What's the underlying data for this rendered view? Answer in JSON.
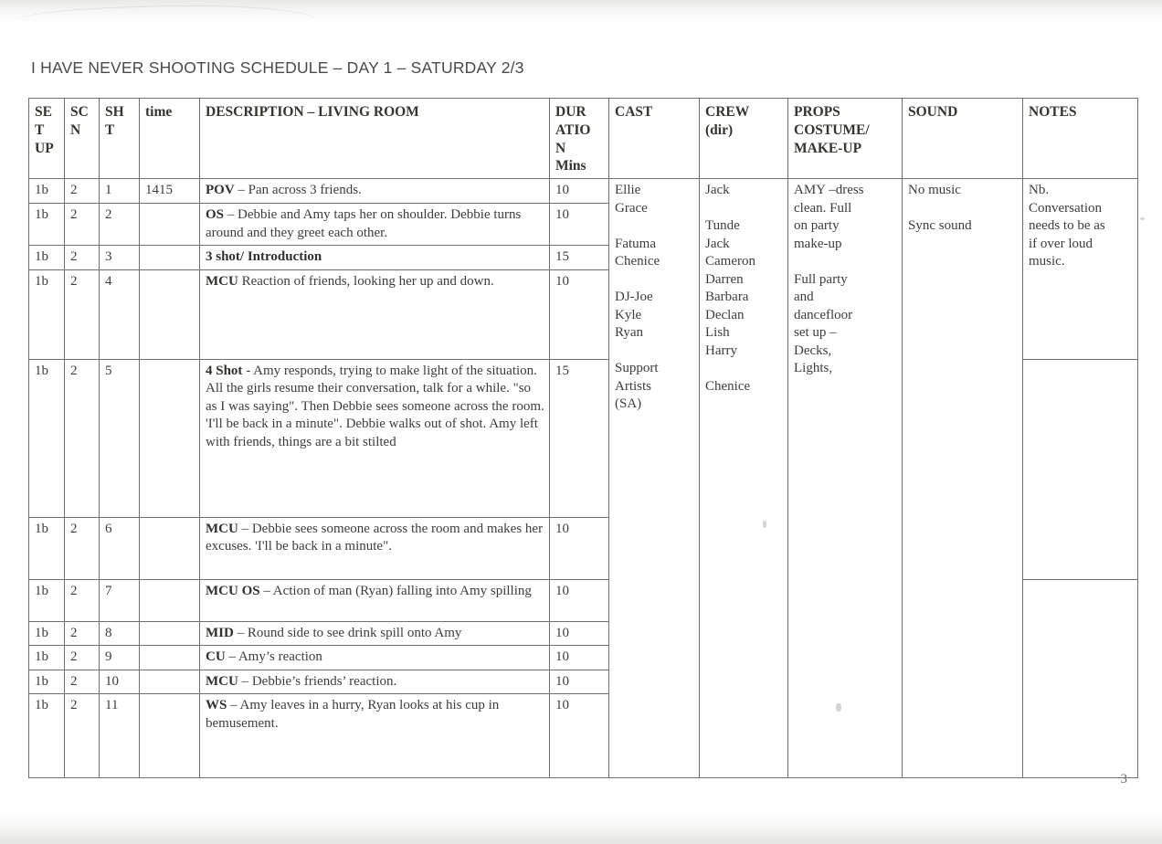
{
  "document": {
    "title": "I HAVE NEVER SHOOTING SCHEDULE – DAY 1 – SATURDAY 2/3",
    "page_number": "3"
  },
  "table": {
    "headers": {
      "setup": "SE\nT\nUP",
      "scn": "SC\nN",
      "sht": "SH\nT",
      "time": "time",
      "description": "DESCRIPTION – LIVING ROOM",
      "duration": "DUR\nATIO\nN\nMins",
      "cast": "CAST",
      "crew": "CREW\n(dir)",
      "props": "PROPS\nCOSTUME/\nMAKE-UP",
      "sound": "SOUND",
      "notes": "NOTES"
    },
    "rows": [
      {
        "setup": "1b",
        "scn": "2",
        "sht": "1",
        "time": "1415",
        "desc_lead": "POV",
        "desc_rest": " – Pan across 3 friends.",
        "duration": "10"
      },
      {
        "setup": "1b",
        "scn": "2",
        "sht": "2",
        "time": "",
        "desc_lead": "OS",
        "desc_rest": " – Debbie and Amy taps her on shoulder. Debbie turns around and they greet each other.",
        "duration": "10"
      },
      {
        "setup": "1b",
        "scn": "2",
        "sht": "3",
        "time": "",
        "desc_lead": "3 shot/ Introduction",
        "desc_rest": "",
        "duration": "15"
      },
      {
        "setup": "1b",
        "scn": "2",
        "sht": "4",
        "time": "",
        "desc_lead": "MCU",
        "desc_rest": " Reaction of friends, looking her up and down.",
        "duration": "10"
      },
      {
        "setup": "1b",
        "scn": "2",
        "sht": "5",
        "time": "",
        "desc_lead": "4 Shot",
        "desc_rest": " - Amy responds, trying to make light of the situation. All the girls resume their conversation, talk for a while. \"so as I was saying\". Then Debbie sees someone across  the room. 'I'll be back in a minute\". Debbie walks out of shot.  Amy left with friends, things are a bit stilted",
        "duration": "15"
      },
      {
        "setup": "1b",
        "scn": "2",
        "sht": "6",
        "time": "",
        "desc_lead": "MCU",
        "desc_rest": " – Debbie sees someone across the room and makes her excuses. 'I'll be back in a minute\".",
        "duration": "10"
      },
      {
        "setup": "1b",
        "scn": "2",
        "sht": "7",
        "time": "",
        "desc_lead": "MCU OS",
        "desc_rest": " – Action of man (Ryan) falling into Amy spilling",
        "duration": "10"
      },
      {
        "setup": "1b",
        "scn": "2",
        "sht": "8",
        "time": "",
        "desc_lead": "MID",
        "desc_rest": " – Round side to see drink spill onto Amy",
        "duration": "10"
      },
      {
        "setup": "1b",
        "scn": "2",
        "sht": "9",
        "time": "",
        "desc_lead": "CU",
        "desc_rest": " – Amy’s reaction",
        "duration": "10"
      },
      {
        "setup": "1b",
        "scn": "2",
        "sht": "10",
        "time": "",
        "desc_lead": "MCU",
        "desc_rest": " – Debbie’s friends’ reaction.",
        "duration": "10"
      },
      {
        "setup": "1b",
        "scn": "2",
        "sht": "11",
        "time": "",
        "desc_lead": "WS",
        "desc_rest": " – Amy leaves in a hurry, Ryan looks at his cup in bemusement.",
        "duration": "10"
      }
    ],
    "side_columns": {
      "cast": "Ellie\nGrace\n\nFatuma\nChenice\n\nDJ-Joe\nKyle\nRyan\n\nSupport\nArtists\n(SA)",
      "crew": "Jack\n\nTunde\nJack\nCameron\nDarren\nBarbara\nDeclan\nLish\nHarry\n\nChenice",
      "props": "AMY –dress\nclean. Full\non party\nmake-up\n\nFull party\nand\ndancefloor\nset up –\nDecks,\nLights,",
      "sound": "No music\n\nSync sound",
      "notes": "Nb.\nConversation\nneeds to be as\nif over loud\nmusic."
    }
  }
}
